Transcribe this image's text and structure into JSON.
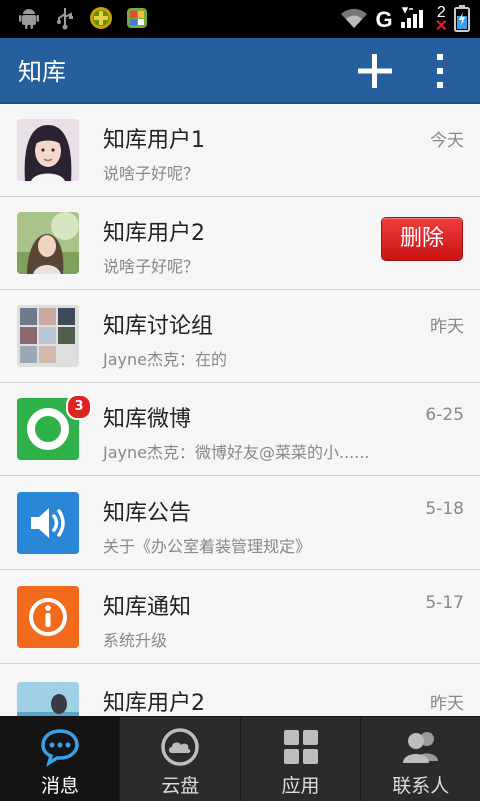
{
  "status_bar": {
    "network": "G",
    "sim_number": "2",
    "sim_mark": "✕"
  },
  "app_bar": {
    "title": "知库"
  },
  "conversations": [
    {
      "name": "知库用户1",
      "preview": "说啥子好呢？",
      "time": "今天"
    },
    {
      "name": "知库用户2",
      "preview": "说啥子好呢？",
      "delete_label": "删除"
    },
    {
      "name": "知库讨论组",
      "preview": "Jayne杰克：在的",
      "time": "昨天"
    },
    {
      "name": "知库微博",
      "preview": "Jayne杰克：微博好友@菜菜的小......",
      "time": "6-25",
      "badge": "3"
    },
    {
      "name": "知库公告",
      "preview": "关于《办公室着装管理规定》",
      "time": "5-18"
    },
    {
      "name": "知库通知",
      "preview": "系统升级",
      "time": "5-17"
    },
    {
      "name": "知库用户2",
      "time": "昨天"
    }
  ],
  "bottom_nav": [
    {
      "label": "消息",
      "icon": "message-icon",
      "active": true
    },
    {
      "label": "云盘",
      "icon": "cloud-icon"
    },
    {
      "label": "应用",
      "icon": "apps-grid-icon"
    },
    {
      "label": "联系人",
      "icon": "contacts-icon"
    }
  ],
  "colors": {
    "app_bar": "#255f9d",
    "delete_button": "#d92626",
    "weibo_tile": "#2fb14a",
    "announce_tile": "#2a86d6",
    "notify_tile": "#f26b1d",
    "active_nav_icon": "#3aa0e8"
  }
}
